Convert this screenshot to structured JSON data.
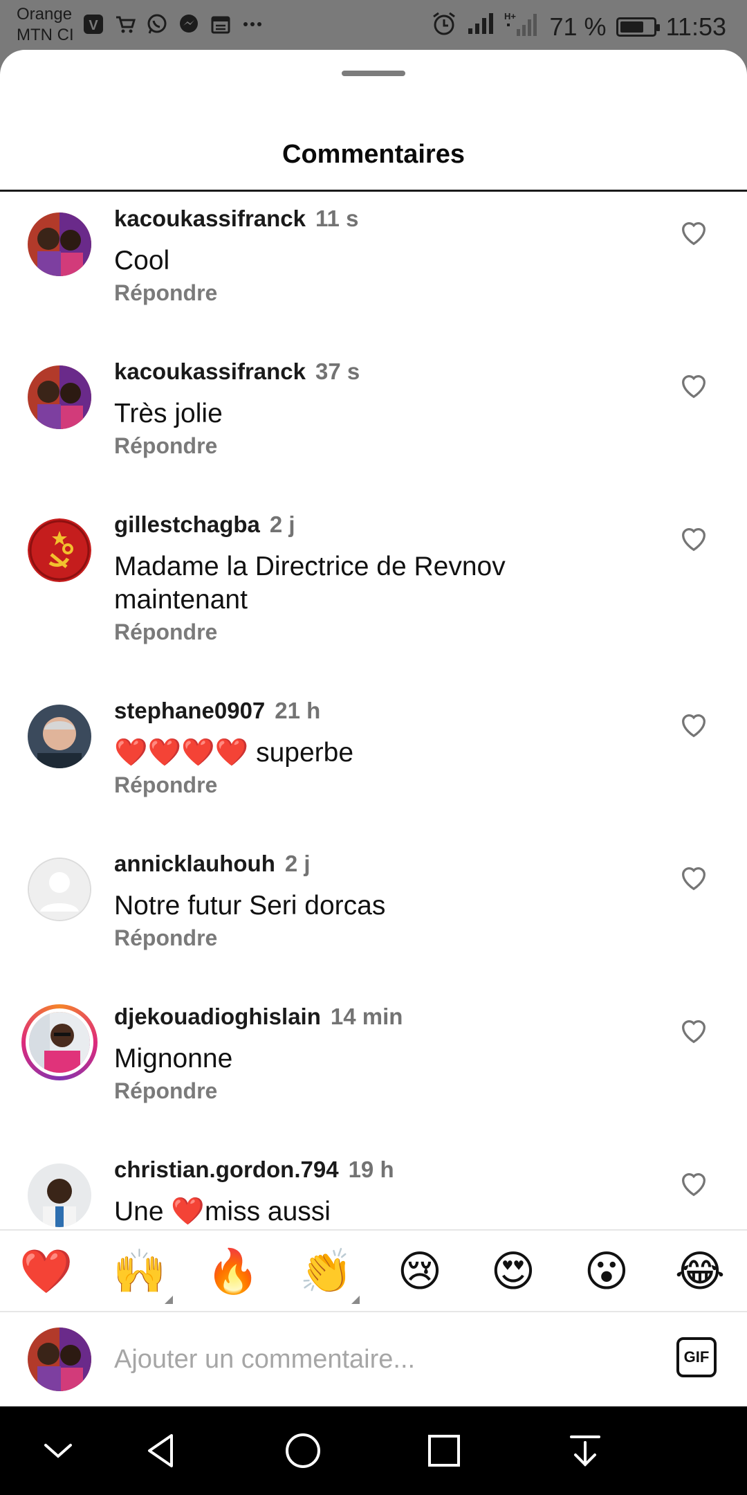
{
  "status_bar": {
    "carrier_line1": "Orange",
    "carrier_line2": "MTN CI",
    "battery_text": "71 %",
    "battery_level": 0.71,
    "time": "11:53",
    "left_icons": [
      "viber-icon",
      "cart-icon",
      "whatsapp-icon",
      "messenger-icon",
      "calendar-icon",
      "more-icon"
    ],
    "right_icons": [
      "alarm-icon",
      "signal-icon",
      "hplus-signal-icon",
      "battery-icon"
    ]
  },
  "sheet": {
    "title": "Commentaires"
  },
  "comments": [
    {
      "username": "kacoukassifranck",
      "time": "11 s",
      "text": "Cool",
      "reply": "Répondre"
    },
    {
      "username": "kacoukassifranck",
      "time": "37 s",
      "text": "Très jolie",
      "reply": "Répondre"
    },
    {
      "username": "gillestchagba",
      "time": "2 j",
      "text": "Madame la Directrice de  Revnov maintenant",
      "reply": "Répondre"
    },
    {
      "username": "stephane0907",
      "time": "21 h",
      "text": "❤️❤️❤️❤️ superbe",
      "reply": "Répondre"
    },
    {
      "username": "annicklauhouh",
      "time": "2 j",
      "text": "Notre futur Seri dorcas",
      "reply": "Répondre"
    },
    {
      "username": "djekouadioghislain",
      "time": "14 min",
      "text": "Mignonne",
      "reply": "Répondre"
    },
    {
      "username": "christian.gordon.794",
      "time": "19 h",
      "text": "Une ❤️miss aussi",
      "reply": ""
    }
  ],
  "emoji_bar": [
    "❤️",
    "🙌",
    "🔥",
    "👏",
    "😢",
    "😍",
    "😮",
    "😂"
  ],
  "input": {
    "placeholder": "Ajouter un commentaire...",
    "gif_label": "GIF"
  },
  "colors": {
    "status_bar_bg": "#7a7a7a",
    "secondary_text": "#737373",
    "nav_bg": "#000000",
    "story_ring_start": "#f58529",
    "story_ring_end": "#8134af"
  }
}
